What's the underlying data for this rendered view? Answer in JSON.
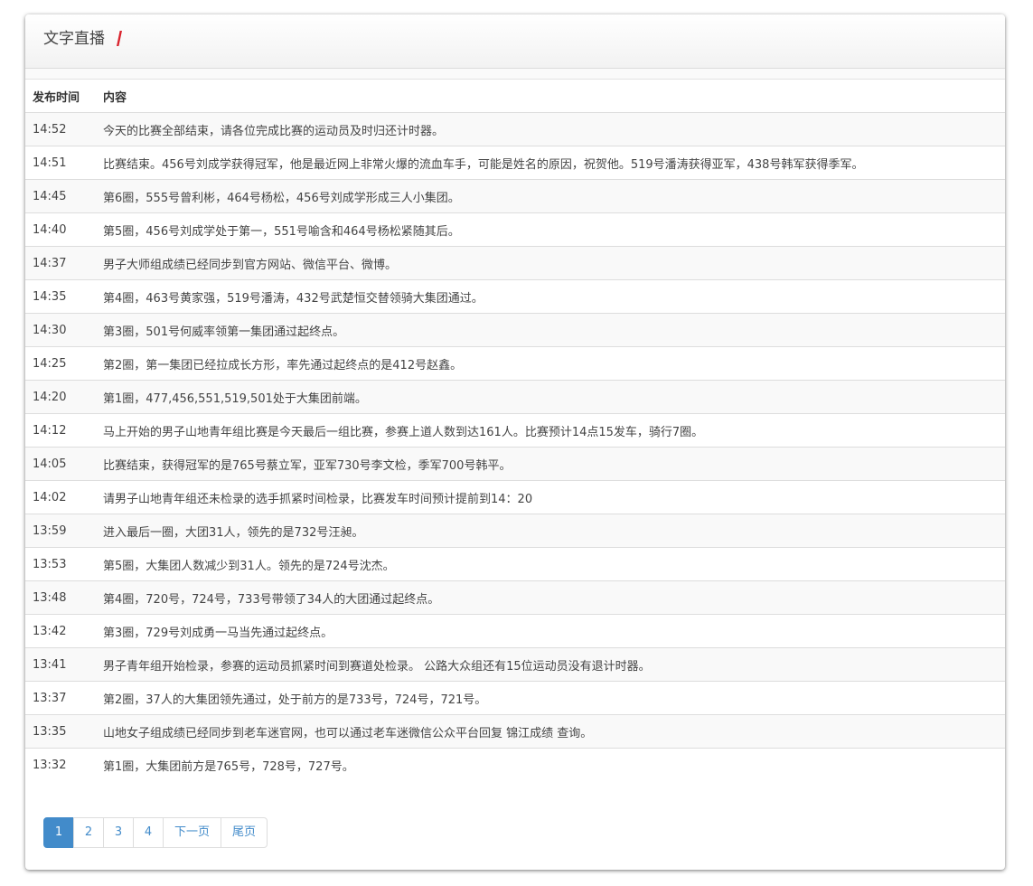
{
  "header": {
    "title": "文字直播",
    "accent_color": "#d9232d"
  },
  "table": {
    "columns": [
      "发布时间",
      "内容"
    ],
    "rows": [
      {
        "time": "14:52",
        "content": "今天的比赛全部结束，请各位完成比赛的运动员及时归还计时器。"
      },
      {
        "time": "14:51",
        "content": "比赛结束。456号刘成学获得冠军，他是最近网上非常火爆的流血车手，可能是姓名的原因，祝贺他。519号潘涛获得亚军，438号韩军获得季军。"
      },
      {
        "time": "14:45",
        "content": "第6圈，555号曾利彬，464号杨松，456号刘成学形成三人小集团。"
      },
      {
        "time": "14:40",
        "content": "第5圈，456号刘成学处于第一，551号喻含和464号杨松紧随其后。"
      },
      {
        "time": "14:37",
        "content": "男子大师组成绩已经同步到官方网站、微信平台、微博。"
      },
      {
        "time": "14:35",
        "content": "第4圈，463号黄家强，519号潘涛，432号武楚恒交替领骑大集团通过。"
      },
      {
        "time": "14:30",
        "content": "第3圈，501号何威率领第一集团通过起终点。"
      },
      {
        "time": "14:25",
        "content": "第2圈，第一集团已经拉成长方形，率先通过起终点的是412号赵鑫。"
      },
      {
        "time": "14:20",
        "content": "第1圈，477,456,551,519,501处于大集团前端。"
      },
      {
        "time": "14:12",
        "content": "马上开始的男子山地青年组比赛是今天最后一组比赛，参赛上道人数到达161人。比赛预计14点15发车，骑行7圈。"
      },
      {
        "time": "14:05",
        "content": "比赛结束，获得冠军的是765号蔡立军，亚军730号李文检，季军700号韩平。"
      },
      {
        "time": "14:02",
        "content": "请男子山地青年组还未检录的选手抓紧时间检录，比赛发车时间预计提前到14：20"
      },
      {
        "time": "13:59",
        "content": "进入最后一圈，大团31人，领先的是732号汪昶。"
      },
      {
        "time": "13:53",
        "content": "第5圈，大集团人数减少到31人。领先的是724号沈杰。"
      },
      {
        "time": "13:48",
        "content": "第4圈，720号，724号，733号带领了34人的大团通过起终点。"
      },
      {
        "time": "13:42",
        "content": "第3圈，729号刘成勇一马当先通过起终点。"
      },
      {
        "time": "13:41",
        "content": "男子青年组开始检录，参赛的运动员抓紧时间到赛道处检录。 公路大众组还有15位运动员没有退计时器。"
      },
      {
        "time": "13:37",
        "content": "第2圈，37人的大集团领先通过，处于前方的是733号，724号，721号。"
      },
      {
        "time": "13:35",
        "content": "山地女子组成绩已经同步到老车迷官网，也可以通过老车迷微信公众平台回复 锦江成绩 查询。"
      },
      {
        "time": "13:32",
        "content": "第1圈，大集团前方是765号，728号，727号。"
      }
    ]
  },
  "pagination": {
    "pages": [
      "1",
      "2",
      "3",
      "4"
    ],
    "active_page": "1",
    "next_label": "下一页",
    "last_label": "尾页",
    "active_color": "#428bca"
  }
}
